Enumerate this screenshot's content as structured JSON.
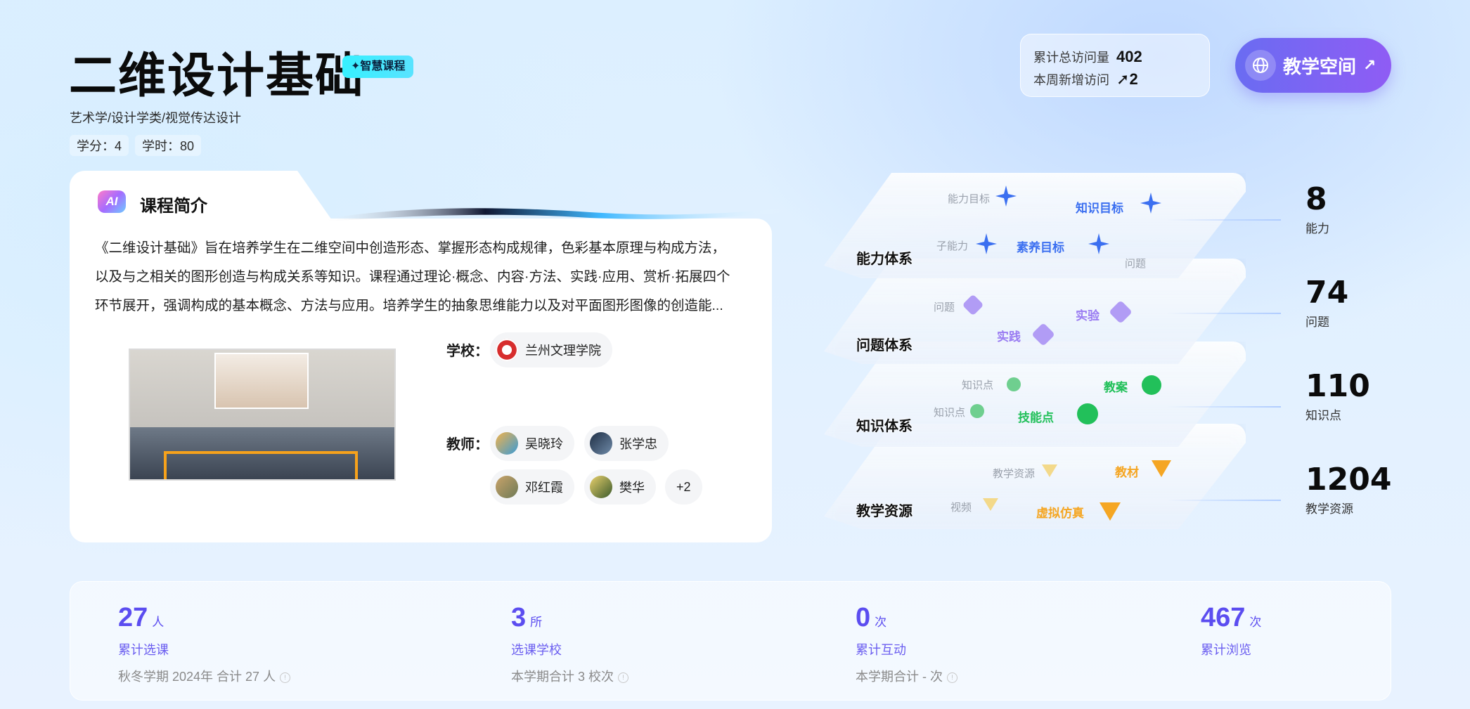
{
  "header": {
    "title": "二维设计基础",
    "badge": "✦智慧课程",
    "category": "艺术学/设计学类/视觉传达设计",
    "credits": "学分：4",
    "hours": "学时：80"
  },
  "visits": {
    "total_label": "累计总访问量",
    "total_value": "402",
    "week_label": "本周新增访问",
    "week_value": "2",
    "week_icon": "arrow-up-icon"
  },
  "space_button": {
    "label": "教学空间",
    "icon": "globe-icon",
    "arrow_icon": "arrow-up-right-icon"
  },
  "intro": {
    "ai_icon_text": "AI",
    "title": "课程简介",
    "lines": [
      "《二维设计基础》旨在培养学生在二维空间中创造形态、掌握形态构成规律，色彩基本原理与构成方法，",
      "以及与之相关的图形创造与构成关系等知识。课程通过理论·概念、内容·方法、实践·应用、赏析·拓展四个",
      "环节展开，强调构成的基本概念、方法与应用。培养学生的抽象思维能力以及对平面图形图像的创造能..."
    ],
    "school_label": "学校：",
    "school_name": "兰州文理学院",
    "teacher_label": "教师：",
    "teachers": [
      "吴晓玲",
      "张学忠",
      "邓红霞",
      "樊华"
    ],
    "more_teachers": "+2"
  },
  "layers": [
    {
      "name": "能力体系",
      "nodes": [
        {
          "label": "能力目标",
          "small": true
        },
        {
          "label": "知识目标",
          "small": false
        },
        {
          "label": "子能力",
          "small": true
        },
        {
          "label": "素养目标",
          "small": false
        },
        {
          "label": "问题",
          "small": true
        }
      ]
    },
    {
      "name": "问题体系",
      "nodes": [
        {
          "label": "问题",
          "small": true
        },
        {
          "label": "实验",
          "small": false
        },
        {
          "label": "实践",
          "small": false
        }
      ]
    },
    {
      "name": "知识体系",
      "nodes": [
        {
          "label": "知识点",
          "small": true
        },
        {
          "label": "教案",
          "small": false
        },
        {
          "label": "知识点",
          "small": true
        },
        {
          "label": "技能点",
          "small": false
        }
      ]
    },
    {
      "name": "教学资源",
      "nodes": [
        {
          "label": "教学资源",
          "small": true
        },
        {
          "label": "教材",
          "small": false
        },
        {
          "label": "视频",
          "small": true
        },
        {
          "label": "虚拟仿真",
          "small": false
        }
      ]
    }
  ],
  "right_stats": [
    {
      "value": "8",
      "label": "能力"
    },
    {
      "value": "74",
      "label": "问题"
    },
    {
      "value": "110",
      "label": "知识点"
    },
    {
      "value": "1204",
      "label": "教学资源"
    }
  ],
  "bottom_stats": [
    {
      "value": "27",
      "unit": "人",
      "label": "累计选课",
      "sub": "秋冬学期 2024年 合计 27 人"
    },
    {
      "value": "3",
      "unit": "所",
      "label": "选课学校",
      "sub": "本学期合计 3 校次"
    },
    {
      "value": "0",
      "unit": "次",
      "label": "累计互动",
      "sub": "本学期合计 - 次"
    },
    {
      "value": "467",
      "unit": "次",
      "label": "累计浏览",
      "sub": ""
    }
  ],
  "colors": {
    "accent": "#5b4df0",
    "badge": "#36f0ff",
    "ability": "#3b6ff0",
    "problem": "#9a7cf2",
    "knowledge": "#22c05a",
    "resource": "#f5a623"
  }
}
